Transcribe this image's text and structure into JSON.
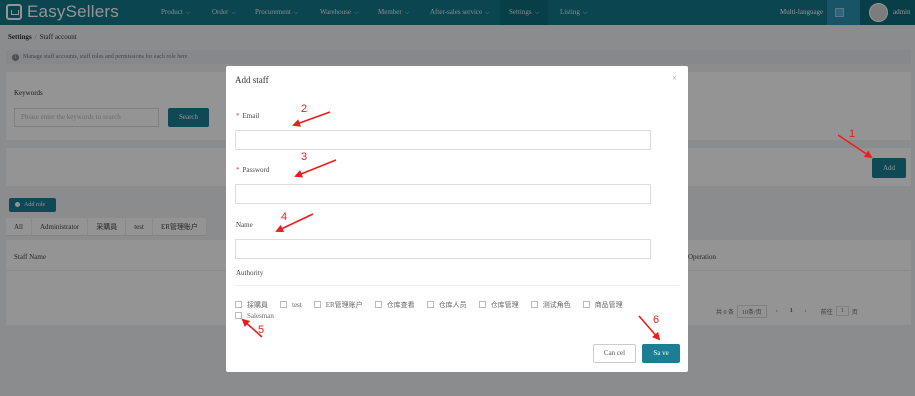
{
  "brand": {
    "name": "EasySellers"
  },
  "nav": {
    "items": [
      {
        "label": "Product"
      },
      {
        "label": "Order"
      },
      {
        "label": "Procurement"
      },
      {
        "label": "Warehouse"
      },
      {
        "label": "Member"
      },
      {
        "label": "After-sales service"
      },
      {
        "label": "Settings"
      },
      {
        "label": "Listing"
      }
    ],
    "active": "Settings",
    "multi_language": "Multi-language",
    "user": "admin"
  },
  "breadcrumb": {
    "root": "Settings",
    "separator": "/",
    "current": "Staff account"
  },
  "notice": "Manage staff accounts, staff roles and permissions for each role here",
  "keywords": {
    "label": "Keywords",
    "placeholder": "Please enter the keywords to search",
    "search_label": "Search"
  },
  "add_label": "Add",
  "add_role_label": "Add role",
  "role_tabs": [
    "All",
    "Administrator",
    "采購員",
    "test",
    "ER管理账户"
  ],
  "table": {
    "headers": [
      "Staff Name",
      "Operation"
    ]
  },
  "pagination": {
    "total": "共 0 条",
    "page_size": "10条/页",
    "prev": "‹",
    "page": "1",
    "next": "›",
    "goto_label": "前往",
    "goto_value": "1",
    "page_unit": "页"
  },
  "modal": {
    "title": "Add staff",
    "close": "×",
    "fields": {
      "email": {
        "label": "Email",
        "required_mark": "*",
        "value": ""
      },
      "password": {
        "label": "Password",
        "required_mark": "*",
        "value": ""
      },
      "name": {
        "label": "Name",
        "value": ""
      }
    },
    "authority_label": "Authority",
    "roles": [
      "採購員",
      "test",
      "ER管理账户",
      "仓库查看",
      "仓库人员",
      "仓库管理",
      "测试角色",
      "商品管理",
      "Salesman"
    ],
    "cancel_label": "Can cel",
    "save_label": "Sa ve"
  },
  "annotations": {
    "numbers": [
      "1",
      "2",
      "3",
      "4",
      "5",
      "6"
    ],
    "color": "#ee1c1c"
  },
  "colors": {
    "primary": "#1b7e94",
    "header": "#14788a",
    "required": "#e33"
  }
}
